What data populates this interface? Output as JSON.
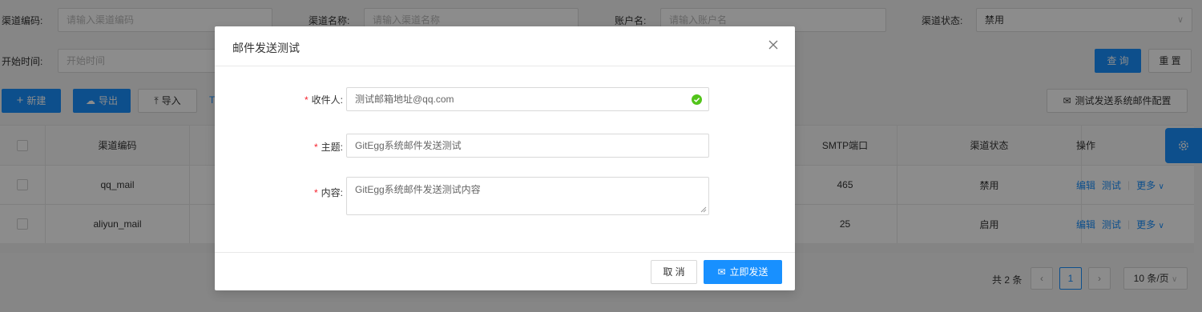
{
  "filters": {
    "code_label": "渠道编码:",
    "code_placeholder": "请输入渠道编码",
    "name_label": "渠道名称:",
    "name_placeholder": "请输入渠道名称",
    "account_label": "账户名:",
    "account_placeholder": "请输入账户名",
    "status_label": "渠道状态:",
    "status_value": "禁用",
    "start_label": "开始时间:",
    "start_placeholder": "开始时间"
  },
  "actions": {
    "query": "查 询",
    "reset": "重 置",
    "new": "新建",
    "export": "导出",
    "import": "导入",
    "partial_link": "T",
    "test_config": "测试发送系统邮件配置"
  },
  "table": {
    "headers": {
      "code": "渠道编码",
      "smtp_port": "SMTP端口",
      "status": "渠道状态",
      "ops": "操作"
    },
    "rows": [
      {
        "code": "qq_mail",
        "smtp_port": "465",
        "status": "禁用"
      },
      {
        "code": "aliyun_mail",
        "smtp_port": "25",
        "status": "启用"
      }
    ],
    "op_edit": "编辑",
    "op_test": "测试",
    "op_more": "更多"
  },
  "pagination": {
    "total": "共 2 条",
    "current_page": "1",
    "page_size": "10 条/页"
  },
  "modal": {
    "title": "邮件发送测试",
    "recipient_label": "收件人:",
    "recipient_value": "测试邮箱地址@qq.com",
    "subject_label": "主题:",
    "subject_value": "GitEgg系统邮件发送测试",
    "content_label": "内容:",
    "content_value": "GitEgg系统邮件发送测试内容",
    "cancel": "取 消",
    "send": "立即发送"
  },
  "colors": {
    "primary": "#1890ff",
    "required": "#f5222d",
    "success": "#52c41a"
  }
}
